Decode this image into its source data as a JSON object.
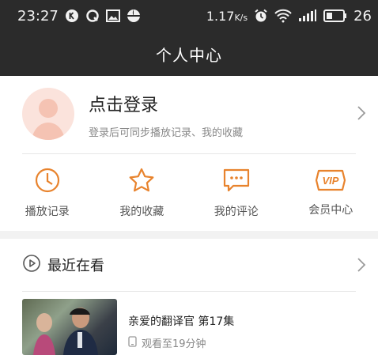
{
  "statusbar": {
    "time": "23:27",
    "left_icons": [
      "k-icon",
      "q-icon",
      "image-icon",
      "sync-icon"
    ],
    "network_speed": "1.17",
    "network_unit": "K/s",
    "battery": "26"
  },
  "header": {
    "title": "个人中心"
  },
  "login": {
    "title": "点击登录",
    "subtitle": "登录后可同步播放记录、我的收藏"
  },
  "quick_actions": [
    {
      "label": "播放记录",
      "icon": "clock-icon"
    },
    {
      "label": "我的收藏",
      "icon": "star-icon"
    },
    {
      "label": "我的评论",
      "icon": "comment-icon"
    },
    {
      "label": "会员中心",
      "icon": "vip-icon"
    }
  ],
  "recent": {
    "title": "最近在看",
    "items": [
      {
        "title": "亲爱的翻译官 第17集",
        "progress": "观看至19分钟"
      }
    ]
  },
  "colors": {
    "accent": "#e8832d",
    "header_bg": "#2b2b2b"
  }
}
